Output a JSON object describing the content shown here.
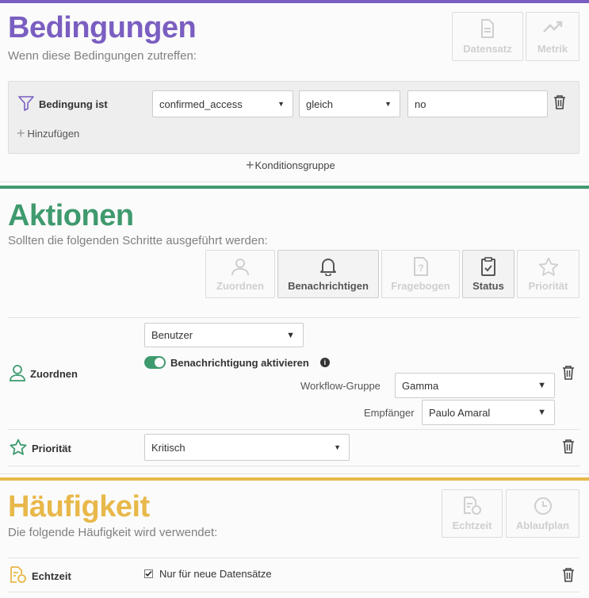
{
  "colors": {
    "conditions": "#7a5ec1",
    "actions": "#3f9a6e",
    "frequency": "#e8b84a"
  },
  "conditions": {
    "title": "Bedingungen",
    "subtitle": "Wenn diese Bedingungen zutreffen:",
    "toolbar": [
      {
        "label": "Datensatz",
        "icon": "document-icon"
      },
      {
        "label": "Metrik",
        "icon": "trending-up-icon"
      }
    ],
    "row": {
      "label": "Bedingung ist",
      "icon": "filter-icon",
      "field": "confirmed_access",
      "operator": "gleich",
      "value": "no"
    },
    "add_label": "Hinzufügen",
    "add_group_label": "Konditionsgruppe"
  },
  "actions": {
    "title": "Aktionen",
    "subtitle": "Sollten die folgenden Schritte ausgeführt werden:",
    "toolbar": [
      {
        "label": "Zuordnen",
        "icon": "user-icon",
        "active": false
      },
      {
        "label": "Benachrichtigen",
        "icon": "bell-icon",
        "active": true
      },
      {
        "label": "Fragebogen",
        "icon": "questionnaire-icon",
        "active": false
      },
      {
        "label": "Status",
        "icon": "clipboard-check-icon",
        "active": true
      },
      {
        "label": "Priorität",
        "icon": "star-icon",
        "active": false
      }
    ],
    "assign": {
      "label": "Zuordnen",
      "target": "Benutzer",
      "notify_label": "Benachrichtigung aktivieren",
      "notify_enabled": true,
      "workflow_group_label": "Workflow-Gruppe",
      "workflow_group": "Gamma",
      "recipient_label": "Empfänger",
      "recipient": "Paulo Amaral"
    },
    "priority": {
      "label": "Priorität",
      "value": "Kritisch"
    }
  },
  "frequency": {
    "title": "Häufigkeit",
    "subtitle": "Die folgende Häufigkeit wird verwendet:",
    "toolbar": [
      {
        "label": "Echtzeit",
        "icon": "realtime-icon"
      },
      {
        "label": "Ablaufplan",
        "icon": "clock-icon"
      }
    ],
    "realtime": {
      "label": "Echtzeit",
      "checkbox_label": "Nur für neue Datensätze",
      "checked": true
    }
  }
}
